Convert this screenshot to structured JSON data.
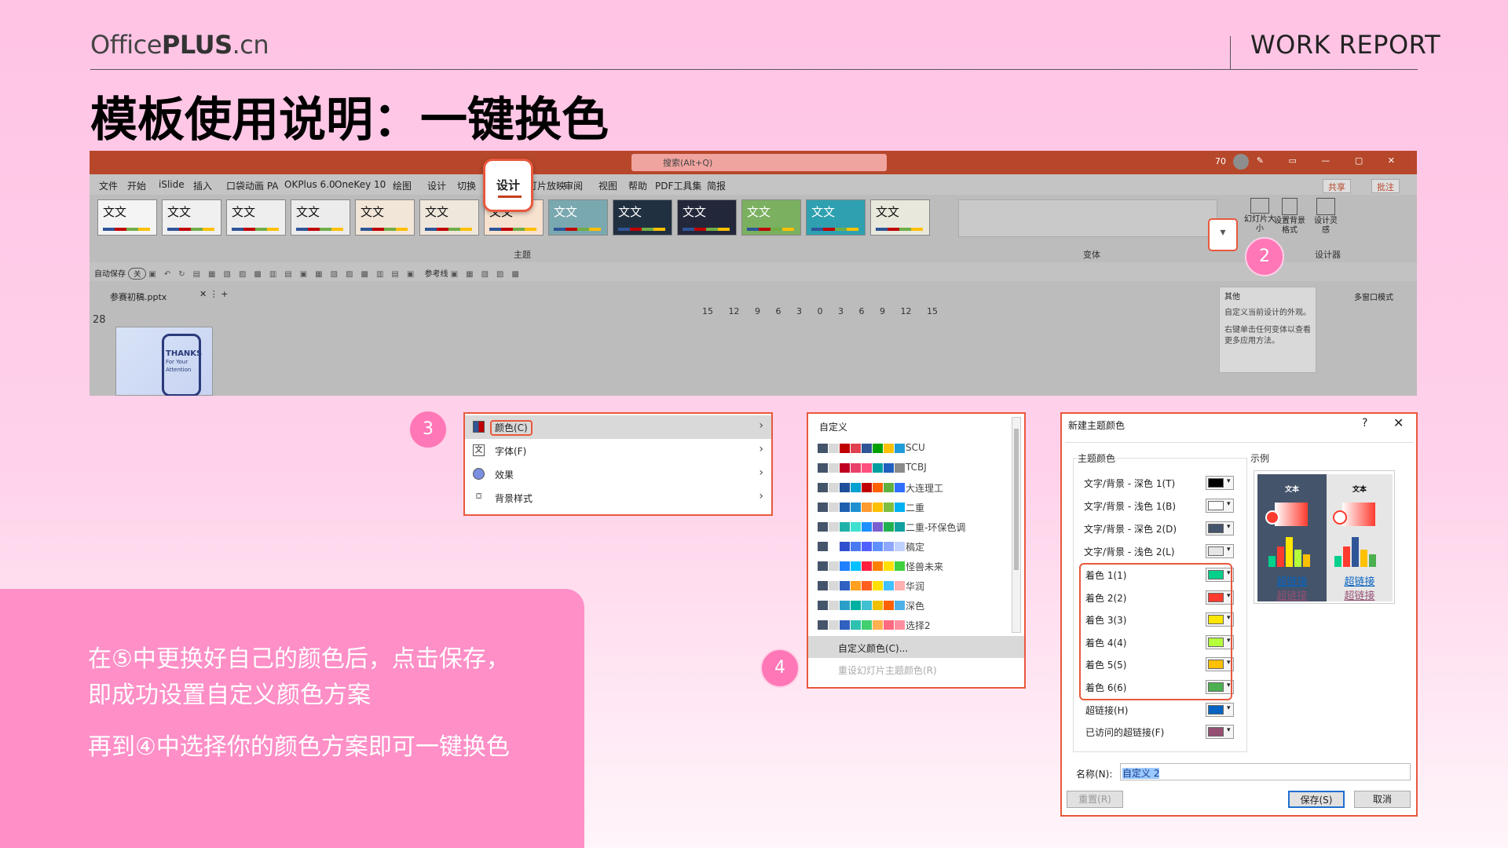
{
  "header": {
    "brand_prefix": "Office",
    "brand_bold": "PLUS",
    "brand_suffix": ".cn",
    "report": "WORK REPORT"
  },
  "title": "模板使用说明：一键换色",
  "ribbon": {
    "search": "搜索(Alt+Q)",
    "zoom": "70",
    "menu_tabs": [
      "文件",
      "开始",
      "iSlide",
      "插入",
      "口袋动画 PA",
      "OKPlus 6.0",
      "OneKey 10",
      "绘图",
      "设计",
      "切换",
      "动画",
      "幻灯片放映",
      "审阅",
      "视图",
      "帮助",
      "PDF工具集",
      "简报"
    ],
    "share": "共享",
    "comment": "批注",
    "design_tab": "设计",
    "theme_label": "主题",
    "theme_text": "文文",
    "variant_label": "变体",
    "right_labels": [
      "幻灯片大小",
      "设置背景格式",
      "设计灵感"
    ],
    "designer_label": "设计器",
    "autosave": "自动保存",
    "toggle": "关",
    "reference": "参考线",
    "file_tab": "参赛初稿.pptx",
    "multiwindow": "多窗口模式",
    "slide_number": "28",
    "ruler": "15 12 9 6 3 0 3 6 9 12 15",
    "thumb_title": "THANKS",
    "thumb_sub": "For Your Attention",
    "tooltip": {
      "title": "其他",
      "line1": "自定义当前设计的外观。",
      "line2": "右键单击任何变体以查看更多应用方法。"
    }
  },
  "steps": [
    "2",
    "3",
    "4",
    "5"
  ],
  "menu3": {
    "items": [
      {
        "label": "颜色(C)",
        "icon": "color-grid-icon"
      },
      {
        "label": "字体(F)",
        "icon": "font-icon"
      },
      {
        "label": "效果",
        "icon": "effects-icon"
      },
      {
        "label": "背景样式",
        "icon": "background-icon"
      }
    ]
  },
  "panel4": {
    "header": "自定义",
    "schemes": [
      {
        "name": "SCU",
        "colors": [
          "#44546a",
          "#d9d9d9",
          "#c00000",
          "#e04050",
          "#2f5597",
          "#00a000",
          "#ffc000",
          "#1f9bd7"
        ]
      },
      {
        "name": "TCBJ",
        "colors": [
          "#44546a",
          "#d9d9d9",
          "#c00020",
          "#e8406a",
          "#ff5080",
          "#00a0a0",
          "#2060c0",
          "#8a8a8a"
        ]
      },
      {
        "name": "大连理工",
        "colors": [
          "#44546a",
          "#d9d9d9",
          "#1f4e9a",
          "#00a0d0",
          "#c00000",
          "#ff6000",
          "#60b040",
          "#3070ff"
        ]
      },
      {
        "name": "二重",
        "colors": [
          "#44546a",
          "#d9d9d9",
          "#1f5fb0",
          "#1e90d0",
          "#ff9a30",
          "#ffc000",
          "#7fbf3f",
          "#00b0f0"
        ]
      },
      {
        "name": "二重-环保色调",
        "colors": [
          "#44546a",
          "#d9d9d9",
          "#20b2aa",
          "#40e0d0",
          "#1e90ff",
          "#7a5fd0",
          "#20b050",
          "#10a0a0"
        ]
      },
      {
        "name": "稿定",
        "colors": [
          "#44546a",
          "#ffffff",
          "#3050d0",
          "#4a7af0",
          "#5060ff",
          "#6090ff",
          "#8fa8ff",
          "#c0d0ff"
        ]
      },
      {
        "name": "怪兽未来",
        "colors": [
          "#44546a",
          "#d9d9d9",
          "#2080ff",
          "#00c0ff",
          "#ff2040",
          "#ff8000",
          "#ffe000",
          "#40d040"
        ]
      },
      {
        "name": "华润",
        "colors": [
          "#44546a",
          "#d9d9d9",
          "#3060c0",
          "#ffa020",
          "#ff6020",
          "#ffe000",
          "#40c0ff",
          "#ffb0b0"
        ]
      },
      {
        "name": "深色",
        "colors": [
          "#44546a",
          "#d9d9d9",
          "#2aa0c8",
          "#00b0a0",
          "#40c0d0",
          "#f0c000",
          "#ff6000",
          "#4fb0e8"
        ]
      },
      {
        "name": "选择2",
        "colors": [
          "#44546a",
          "#d9d9d9",
          "#3060c0",
          "#30c0b0",
          "#40d070",
          "#ffb050",
          "#ff6a80",
          "#ff8fa0"
        ]
      }
    ],
    "custom": "自定义颜色(C)...",
    "reset": "重设幻灯片主题颜色(R)"
  },
  "dialog": {
    "title": "新建主题颜色",
    "help": "?",
    "close": "✕",
    "section": "主题颜色",
    "example": "示例",
    "rows": [
      {
        "label": "文字/背景 - 深色 1(T)",
        "color": "#000000"
      },
      {
        "label": "文字/背景 - 浅色 1(B)",
        "color": "#ffffff"
      },
      {
        "label": "文字/背景 - 深色 2(D)",
        "color": "#44546a"
      },
      {
        "label": "文字/背景 - 浅色 2(L)",
        "color": "#e7e6e6"
      },
      {
        "label": "着色 1(1)",
        "color": "#00d08a"
      },
      {
        "label": "着色 2(2)",
        "color": "#ff3b2f"
      },
      {
        "label": "着色 3(3)",
        "color": "#ffe600"
      },
      {
        "label": "着色 4(4)",
        "color": "#b6ff3b"
      },
      {
        "label": "着色 5(5)",
        "color": "#ffc000"
      },
      {
        "label": "着色 6(6)",
        "color": "#4caf50"
      },
      {
        "label": "超链接(H)",
        "color": "#0563c1"
      },
      {
        "label": "已访问的超链接(F)",
        "color": "#954f72"
      }
    ],
    "example_text": "文本",
    "example_link": "超链接",
    "name_label": "名称(N):",
    "name_value": "自定义 2",
    "reset_btn": "重置(R)",
    "save_btn": "保存(S)",
    "cancel_btn": "取消"
  },
  "note": {
    "line1": "在⑤中更换好自己的颜色后，点击保存，",
    "line2": "即成功设置自定义颜色方案",
    "line3": "再到④中选择你的颜色方案即可一键换色"
  },
  "colors": {
    "accent": "#e8583d",
    "pink_circle": "#ff77b7",
    "note_bg": "#fe8fc7"
  }
}
